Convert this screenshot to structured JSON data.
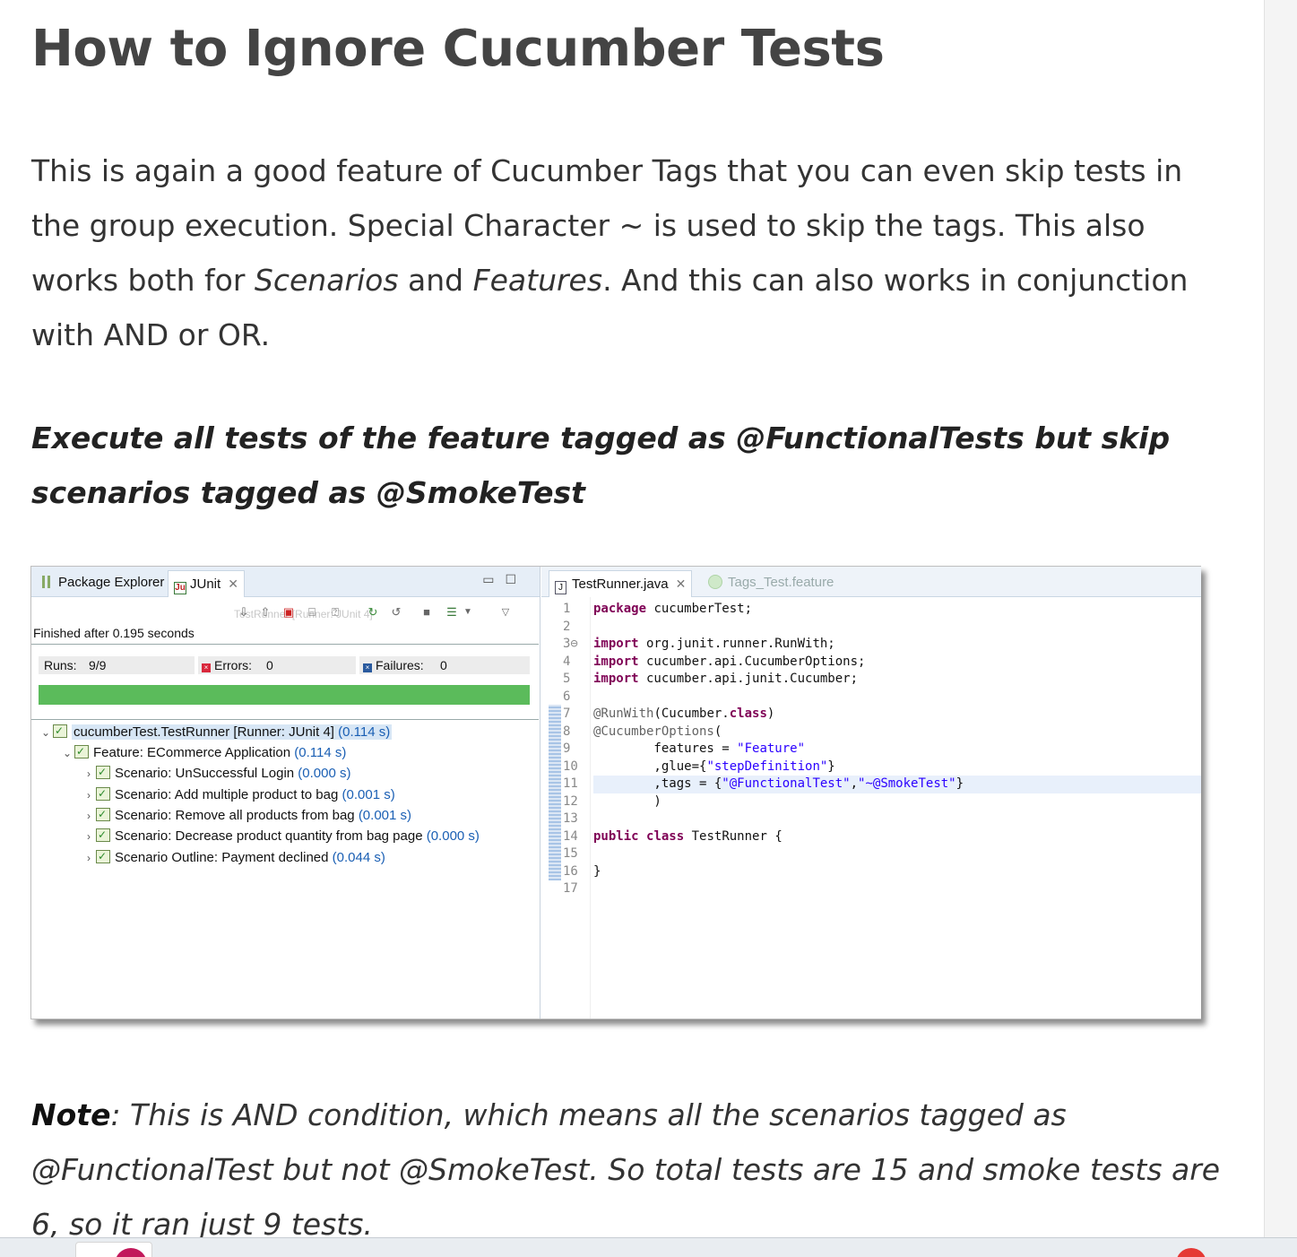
{
  "article": {
    "title": "How to Ignore Cucumber Tests",
    "para_part1": "This is again a good feature of Cucumber Tags that you can even skip tests in the group execution. Special Character ~ is used to skip the tags. This also works both for ",
    "para_em1": "Scenarios",
    "para_part2": " and ",
    "para_em2": "Features",
    "para_part3": ". And this can also works in conjunction with AND or OR.",
    "subheading": "Execute all tests of the feature tagged as @FunctionalTests but skip scenarios tagged as @SmokeTest",
    "note_label": "Note",
    "note_text": ": This is AND condition, which means all the scenarios tagged as @FunctionalTest but not @SmokeTest. So total tests are 15 and smoke tests are 6, so it ran just 9 tests."
  },
  "ide": {
    "left_tabs": [
      "Package Explorer",
      "JUnit"
    ],
    "toolbar_ghost": "TestRunner [Runner: JUnit 4]",
    "finished": "Finished after 0.195 seconds",
    "runs_label": "Runs:",
    "runs_value": "9/9",
    "errors_label": "Errors:",
    "errors_value": "0",
    "failures_label": "Failures:",
    "failures_value": "0",
    "progress": 1.0,
    "progress_color": "#5bbb5b",
    "tree": [
      {
        "label": "cucumberTest.TestRunner [Runner: JUnit 4]",
        "time": "(0.114 s)"
      },
      {
        "label": "Feature: ECommerce Application",
        "time": "(0.114 s)"
      },
      {
        "label": "Scenario: UnSuccessful Login",
        "time": "(0.000 s)"
      },
      {
        "label": "Scenario: Add multiple product to bag",
        "time": "(0.001 s)"
      },
      {
        "label": "Scenario: Remove all products from bag",
        "time": "(0.001 s)"
      },
      {
        "label": "Scenario: Decrease product quantity from bag page",
        "time": "(0.000 s)"
      },
      {
        "label": "Scenario Outline: Payment declined",
        "time": "(0.044 s)"
      }
    ],
    "editor_tabs": [
      "TestRunner.java",
      "Tags_Test.feature"
    ],
    "line_numbers": [
      "1",
      "2",
      "3⊖",
      "4",
      "5",
      "6",
      "7",
      "8",
      "9",
      "10",
      "11",
      "12",
      "13",
      "14",
      "15",
      "16",
      "17"
    ]
  }
}
